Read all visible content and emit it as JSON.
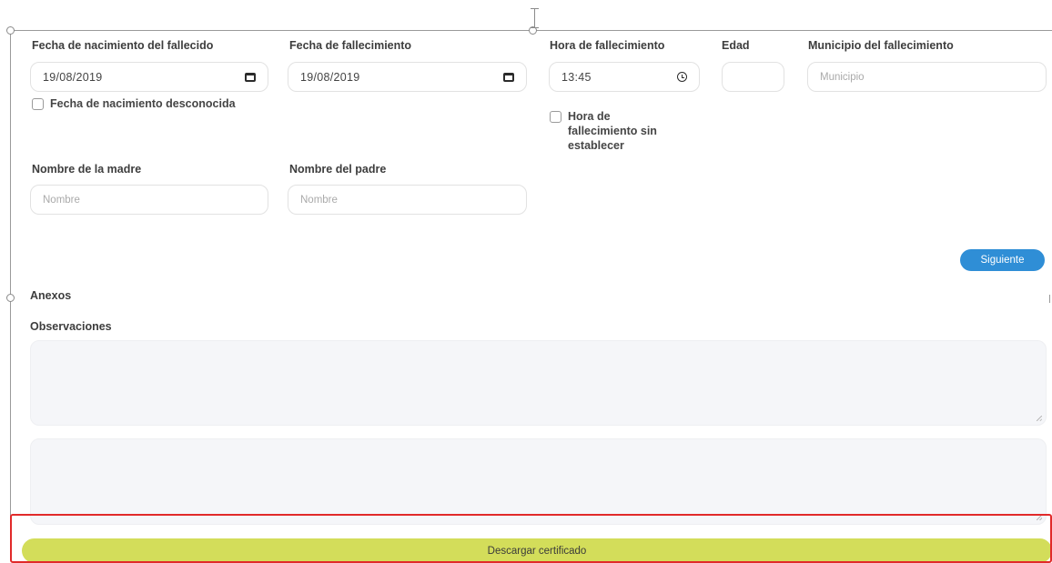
{
  "form": {
    "birth_date": {
      "label": "Fecha de nacimiento del fallecido",
      "value": "19/08/2019",
      "unknown_label": "Fecha de nacimiento desconocida"
    },
    "death_date": {
      "label": "Fecha de fallecimiento",
      "value": "19/08/2019"
    },
    "death_time": {
      "label": "Hora de fallecimiento",
      "value": "13:45",
      "unset_label_lines": [
        "Hora de",
        "fallecimiento sin",
        "establecer"
      ]
    },
    "age": {
      "label": "Edad",
      "value": ""
    },
    "municipality": {
      "label": "Municipio del fallecimiento",
      "placeholder": "Municipio"
    },
    "mother_name": {
      "label": "Nombre de la madre",
      "placeholder": "Nombre"
    },
    "father_name": {
      "label": "Nombre del padre",
      "placeholder": "Nombre"
    }
  },
  "buttons": {
    "next": "Siguiente",
    "download": "Descargar certificado"
  },
  "sections": {
    "attachments": "Anexos",
    "observations": "Observaciones"
  },
  "colors": {
    "next_button": "#2f8ed6",
    "download_button": "#d3dd5a",
    "highlight_border": "#e12a2a",
    "textarea_bg": "#f5f6f9"
  },
  "icons": {
    "date": "calendar-icon",
    "time": "clock-icon"
  }
}
